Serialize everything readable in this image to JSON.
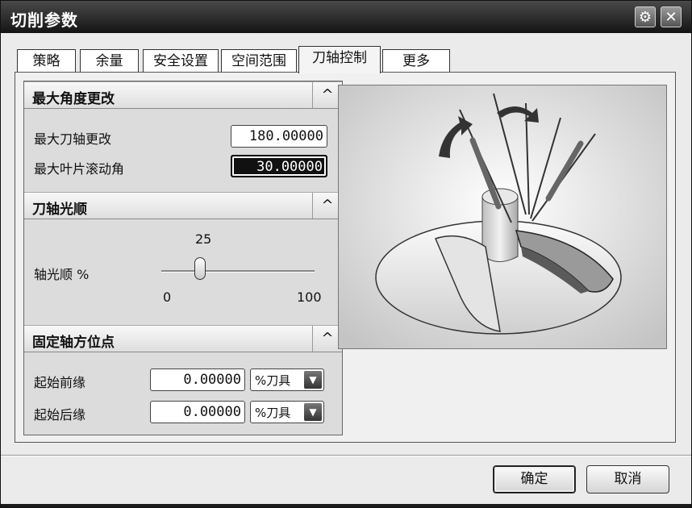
{
  "window": {
    "title": "切削参数"
  },
  "tabs": [
    {
      "label": "策略"
    },
    {
      "label": "余量"
    },
    {
      "label": "安全设置"
    },
    {
      "label": "空间范围"
    },
    {
      "label": "刀轴控制",
      "active": true
    },
    {
      "label": "更多"
    }
  ],
  "sections": {
    "max_angle": {
      "title": "最大角度更改",
      "rows": [
        {
          "label": "最大刀轴更改",
          "value": "180.00000"
        },
        {
          "label": "最大叶片滚动角",
          "value": "30.00000"
        }
      ]
    },
    "smooth": {
      "title": "刀轴光顺",
      "label": "轴光顺 %",
      "slider": {
        "value": 25,
        "min": 0,
        "max": 100,
        "value_text": "25",
        "min_text": "0",
        "max_text": "100"
      }
    },
    "fixed": {
      "title": "固定轴方位点",
      "rows": [
        {
          "label": "起始前缘",
          "value": "0.00000",
          "unit": "%刀具"
        },
        {
          "label": "起始后缘",
          "value": "0.00000",
          "unit": "%刀具"
        }
      ]
    }
  },
  "icons": {
    "collapse": "^",
    "close": "✕",
    "settings": "⚙",
    "dropdown": "▼"
  },
  "buttons": {
    "ok": "确定",
    "cancel": "取消"
  },
  "colors": {
    "titlebar": "#1f1f1f",
    "panel": "#dcdcdc",
    "selection": "#111111"
  }
}
